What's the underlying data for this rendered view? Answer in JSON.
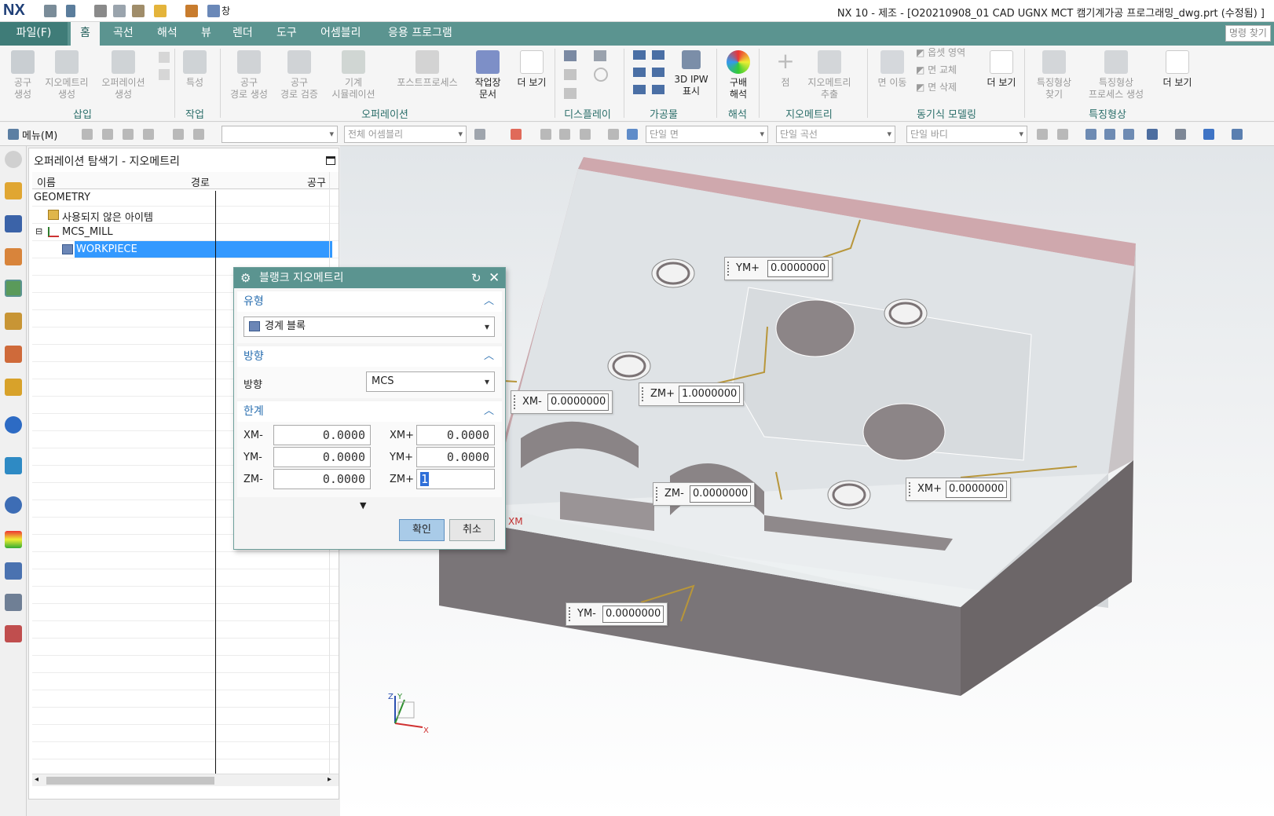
{
  "app": {
    "logo": "NX",
    "title": "NX 10 - 제조 - [O20210908_01 CAD UGNX MCT 캠기계가공 프로그래밍_dwg.prt (수정됨) ]",
    "quick_window": "창"
  },
  "tabs": {
    "file": "파일(F)",
    "items": [
      "홈",
      "곡선",
      "해석",
      "뷰",
      "렌더",
      "도구",
      "어셈블리",
      "응용 프로그램"
    ],
    "active": "홈",
    "command_finder": "명령 찾기"
  },
  "ribbon": {
    "buttons": [
      {
        "label": "공구\n생성",
        "enabled": false
      },
      {
        "label": "지오메트리\n생성",
        "enabled": false
      },
      {
        "label": "오퍼레이션\n생성",
        "enabled": false
      },
      {
        "label": "특성",
        "enabled": false
      },
      {
        "label": "공구\n경로 생성",
        "enabled": false
      },
      {
        "label": "공구\n경로 검증",
        "enabled": false
      },
      {
        "label": "기계\n시뮬레이션",
        "enabled": false
      },
      {
        "label": "포스트프로세스",
        "enabled": false
      },
      {
        "label": "작업장\n문서",
        "enabled": true
      },
      {
        "label": "더 보기",
        "enabled": true
      },
      {
        "label": "3D IPW\n표시",
        "enabled": true
      },
      {
        "label": "구배\n해석",
        "enabled": true
      },
      {
        "label": "점",
        "enabled": false
      },
      {
        "label": "지오메트리\n추출",
        "enabled": false
      },
      {
        "label": "면 이동",
        "enabled": false
      },
      {
        "label": "옵셋 영역",
        "enabled": false
      },
      {
        "label": "면 교체",
        "enabled": false
      },
      {
        "label": "면 삭제",
        "enabled": false
      },
      {
        "label": "더 보기",
        "enabled": true
      },
      {
        "label": "특징형상\n찾기",
        "enabled": false
      },
      {
        "label": "특징형상\n프로세스 생성",
        "enabled": false
      },
      {
        "label": "더 보기",
        "enabled": true
      }
    ],
    "groups": [
      "삽입",
      "작업",
      "오퍼레이션",
      "디스플레이",
      "가공물",
      "해석",
      "지오메트리",
      "동기식 모델링",
      "특징형상"
    ]
  },
  "toolbar2": {
    "menu": "메뉴(M)",
    "combo1": "",
    "assembly_filter": "전체 어셈블리",
    "face_rule": "단일 면",
    "curve_rule": "단일 곡선",
    "body_rule": "단일 바디"
  },
  "navigator": {
    "title": "오퍼레이션 탐색기 - 지오메트리",
    "columns": [
      "이름",
      "경로",
      "공구"
    ],
    "rows": [
      "GEOMETRY",
      "사용되지 않은 아이템",
      "MCS_MILL",
      "WORKPIECE"
    ],
    "selected": "WORKPIECE"
  },
  "dialog": {
    "title": "블랭크 지오메트리",
    "type_section": "유형",
    "type_value": "경계 블록",
    "direction_section": "방향",
    "direction_label": "방향",
    "direction_value": "MCS",
    "limits_section": "한계",
    "limits": {
      "xm_label": "XM-",
      "xm": "0.0000",
      "xp_label": "XM+",
      "xp": "0.0000",
      "ym_label": "YM-",
      "ym": "0.0000",
      "yp_label": "YM+",
      "yp": "0.0000",
      "zm_label": "ZM-",
      "zm": "0.0000",
      "zp_label": "ZM+",
      "zp": "1"
    },
    "ok": "확인",
    "cancel": "취소"
  },
  "viewport_tags": {
    "yp": {
      "label": "YM+",
      "value": "0.0000000"
    },
    "xm": {
      "label": "XM-",
      "value": "0.0000000"
    },
    "zp": {
      "label": "ZM+",
      "value": "1.0000000"
    },
    "zm": {
      "label": "ZM-",
      "value": "0.0000000"
    },
    "xp": {
      "label": "XM+",
      "value": "0.0000000"
    },
    "ym": {
      "label": "YM-",
      "value": "0.0000000"
    }
  },
  "triad": {
    "x": "X",
    "y": "Y",
    "z": "Z",
    "xm_marker": "XM"
  },
  "colors": {
    "accent": "#5b9490",
    "selection": "#3399ff",
    "blank_top": "#d8dde2",
    "blank_side": "#9a8e92",
    "handle": "#b8963a"
  }
}
